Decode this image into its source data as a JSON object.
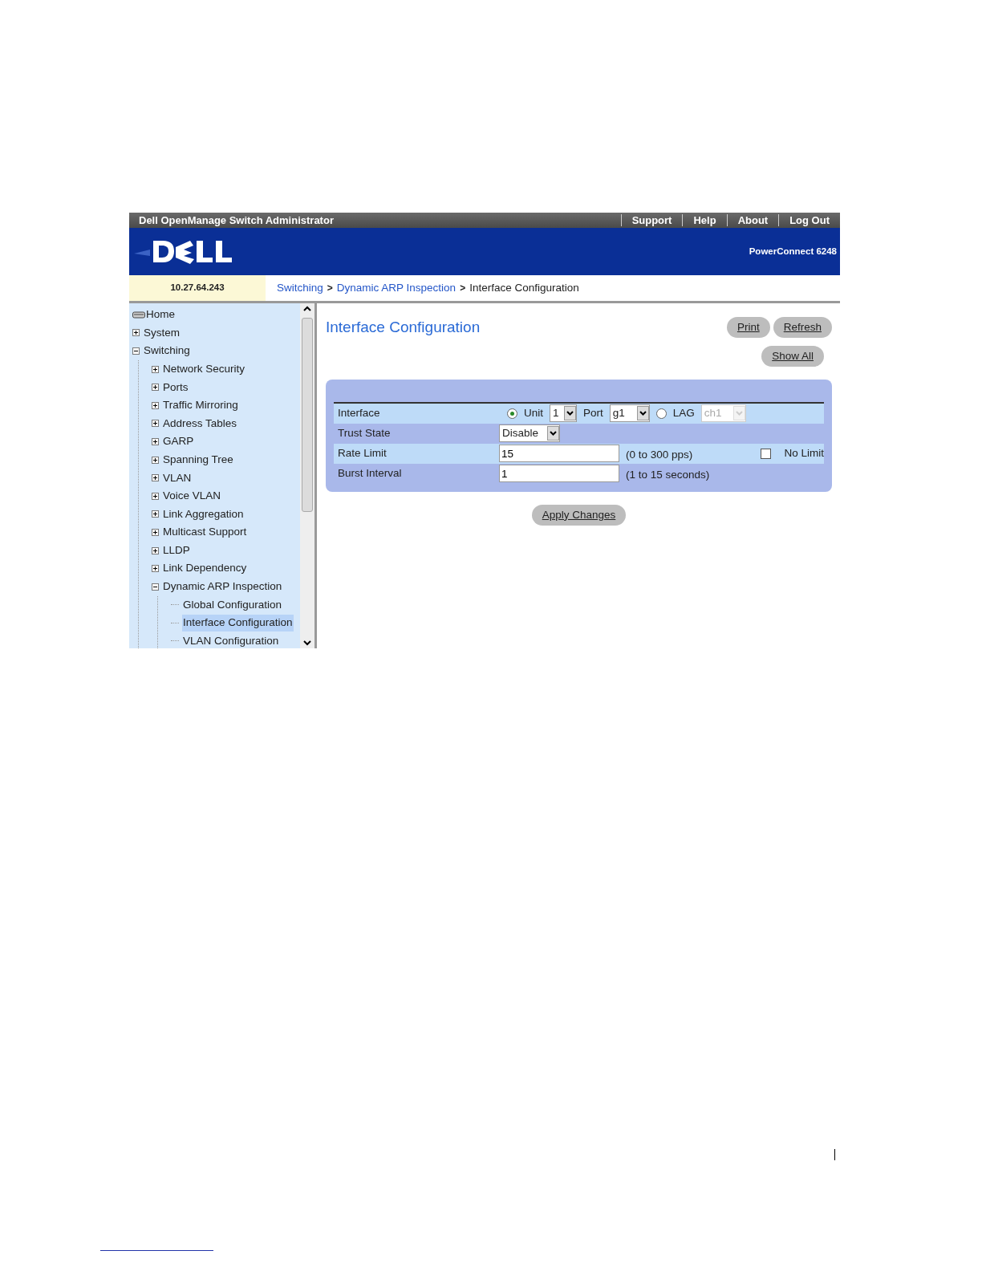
{
  "header": {
    "title": "Dell OpenManage Switch Administrator",
    "links": [
      "Support",
      "Help",
      "About",
      "Log Out"
    ],
    "model": "PowerConnect 6248",
    "ip": "10.27.64.243"
  },
  "breadcrumb": [
    {
      "label": "Switching",
      "kind": "link"
    },
    {
      "label": ">",
      "kind": "sep"
    },
    {
      "label": "Dynamic ARP Inspection",
      "kind": "link"
    },
    {
      "label": ">",
      "kind": "sep"
    },
    {
      "label": "Interface Configuration",
      "kind": "current"
    }
  ],
  "sidebar": {
    "items": [
      {
        "label": "Home",
        "kind": "home",
        "selected": false
      },
      {
        "label": "System",
        "kind": "folder",
        "expanded": false,
        "selected": false
      },
      {
        "label": "Switching",
        "kind": "folder",
        "expanded": true,
        "selected": false,
        "children": [
          {
            "label": "Network Security",
            "kind": "folder",
            "expanded": false,
            "selected": false
          },
          {
            "label": "Ports",
            "kind": "folder",
            "expanded": false,
            "selected": false
          },
          {
            "label": "Traffic Mirroring",
            "kind": "folder",
            "expanded": false,
            "selected": false
          },
          {
            "label": "Address Tables",
            "kind": "folder",
            "expanded": false,
            "selected": false
          },
          {
            "label": "GARP",
            "kind": "folder",
            "expanded": false,
            "selected": false
          },
          {
            "label": "Spanning Tree",
            "kind": "folder",
            "expanded": false,
            "selected": false
          },
          {
            "label": "VLAN",
            "kind": "folder",
            "expanded": false,
            "selected": false
          },
          {
            "label": "Voice VLAN",
            "kind": "folder",
            "expanded": false,
            "selected": false
          },
          {
            "label": "Link Aggregation",
            "kind": "folder",
            "expanded": false,
            "selected": false
          },
          {
            "label": "Multicast Support",
            "kind": "folder",
            "expanded": false,
            "selected": false
          },
          {
            "label": "LLDP",
            "kind": "folder",
            "expanded": false,
            "selected": false
          },
          {
            "label": "Link Dependency",
            "kind": "folder",
            "expanded": false,
            "selected": false
          },
          {
            "label": "Dynamic ARP Inspection",
            "kind": "folder",
            "expanded": true,
            "selected": false,
            "children": [
              {
                "label": "Global Configuration",
                "kind": "page",
                "selected": false
              },
              {
                "label": "Interface Configuration",
                "kind": "page",
                "selected": true
              },
              {
                "label": "VLAN Configuration",
                "kind": "page",
                "selected": false
              }
            ]
          }
        ]
      }
    ]
  },
  "content": {
    "title": "Interface Configuration",
    "buttons": [
      "Print",
      "Refresh"
    ],
    "show_all": "Show All",
    "interface": {
      "label": "Interface",
      "unit": {
        "label": "Unit",
        "selected": true,
        "value": "1"
      },
      "port": {
        "label": "Port",
        "value": "g1"
      },
      "lag": {
        "label": "LAG",
        "selected": false,
        "value": "ch1",
        "disabled": true
      }
    },
    "trust_state": {
      "label": "Trust State",
      "value": "Disable"
    },
    "rate_limit": {
      "label": "Rate Limit",
      "value": "15",
      "hint": "(0 to 300 pps)",
      "no_limit": {
        "label": "No Limit",
        "checked": false
      }
    },
    "burst_interval": {
      "label": "Burst Interval",
      "value": "1",
      "hint": "(1 to 15 seconds)"
    },
    "apply": "Apply Changes"
  }
}
